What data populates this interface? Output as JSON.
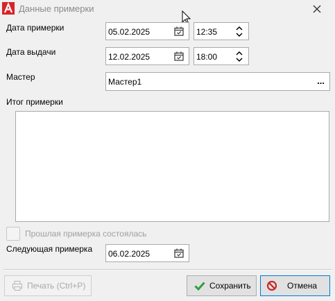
{
  "window": {
    "title": "Данные примерки",
    "close_glyph": "✕"
  },
  "fitting_date": {
    "label": "Дата примерки",
    "date": "05.02.2025",
    "time": "12:35"
  },
  "issue_date": {
    "label": "Дата выдачи",
    "date": "12.02.2025",
    "time": "18:00"
  },
  "master": {
    "label": "Мастер",
    "value": "Мастер1",
    "browse_label": "..."
  },
  "fitting_result": {
    "label": "Итог примерки",
    "value": ""
  },
  "fitting_done": {
    "label": "Прошлая примерка состоялась",
    "checked": false
  },
  "next_fitting": {
    "label": "Следующая примерка",
    "date": "06.02.2025"
  },
  "buttons": {
    "print": "Печать (Ctrl+P)",
    "save": "Сохранить",
    "cancel": "Отмена"
  },
  "colors": {
    "app_icon_red": "#d8232a",
    "save_check_green": "#2e9e3e",
    "cancel_red": "#c62828"
  }
}
